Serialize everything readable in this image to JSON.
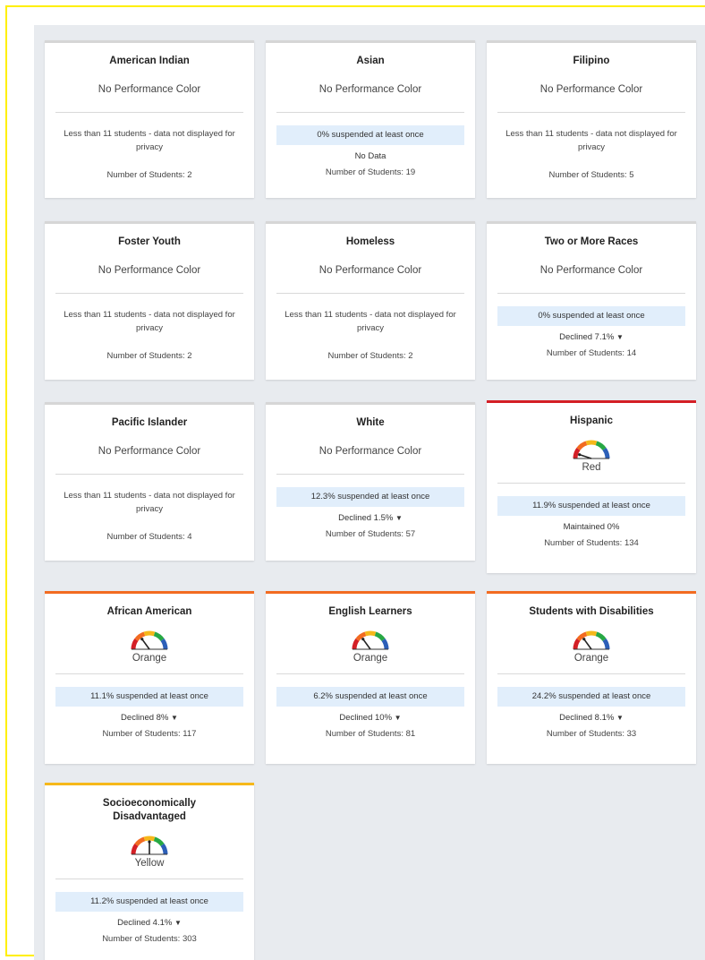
{
  "cards": [
    {
      "title": "American Indian",
      "performance": "No Performance Color",
      "privacy_note": "Less than 11 students - data not displayed for privacy",
      "students": "Number of Students: 2"
    },
    {
      "title": "Asian",
      "performance": "No Performance Color",
      "rate": "0% suspended at least once",
      "change": "No Data",
      "students": "Number of Students: 19"
    },
    {
      "title": "Filipino",
      "performance": "No Performance Color",
      "privacy_note": "Less than 11 students - data not displayed for privacy",
      "students": "Number of Students: 5"
    },
    {
      "title": "Foster Youth",
      "performance": "No Performance Color",
      "privacy_note": "Less than 11 students - data not displayed for privacy",
      "students": "Number of Students: 2"
    },
    {
      "title": "Homeless",
      "performance": "No Performance Color",
      "privacy_note": "Less than 11 students - data not displayed for privacy",
      "students": "Number of Students: 2"
    },
    {
      "title": "Two or More Races",
      "performance": "No Performance Color",
      "rate": "0% suspended at least once",
      "change": "Declined 7.1%",
      "change_icon": "down-triangle-icon",
      "students": "Number of Students: 14"
    },
    {
      "title": "Pacific Islander",
      "performance": "No Performance Color",
      "privacy_note": "Less than 11 students - data not displayed for privacy",
      "students": "Number of Students: 4"
    },
    {
      "title": "White",
      "performance": "No Performance Color",
      "rate": "12.3% suspended at least once",
      "change": "Declined 1.5%",
      "change_icon": "down-triangle-icon",
      "students": "Number of Students: 57"
    },
    {
      "title": "Hispanic",
      "color_label": "Red",
      "gauge": "red",
      "accent": "#d41f26",
      "rate": "11.9% suspended at least once",
      "change": "Maintained 0%",
      "students": "Number of Students: 134"
    },
    {
      "title": "African American",
      "color_label": "Orange",
      "gauge": "orange",
      "accent": "#f26b21",
      "rate": "11.1% suspended at least once",
      "change": "Declined 8%",
      "change_icon": "down-triangle-icon",
      "students": "Number of Students: 117"
    },
    {
      "title": "English Learners",
      "color_label": "Orange",
      "gauge": "orange",
      "accent": "#f26b21",
      "rate": "6.2% suspended at least once",
      "change": "Declined 10%",
      "change_icon": "down-triangle-icon",
      "students": "Number of Students: 81"
    },
    {
      "title": "Students with Disabilities",
      "color_label": "Orange",
      "gauge": "orange",
      "accent": "#f26b21",
      "rate": "24.2% suspended at least once",
      "change": "Declined 8.1%",
      "change_icon": "down-triangle-icon",
      "students": "Number of Students: 33"
    },
    {
      "title": "Socioeconomically Disadvantaged",
      "color_label": "Yellow",
      "gauge": "yellow",
      "accent": "#f6b81a",
      "rate": "11.2% suspended at least once",
      "change": "Declined 4.1%",
      "change_icon": "down-triangle-icon",
      "students": "Number of Students: 303"
    }
  ],
  "gauge_colors": {
    "red": "#d41f26",
    "orange": "#f26b21",
    "yellow": "#f6b81a",
    "green": "#27a844",
    "blue": "#2c5fb8"
  },
  "down_triangle": "▼"
}
